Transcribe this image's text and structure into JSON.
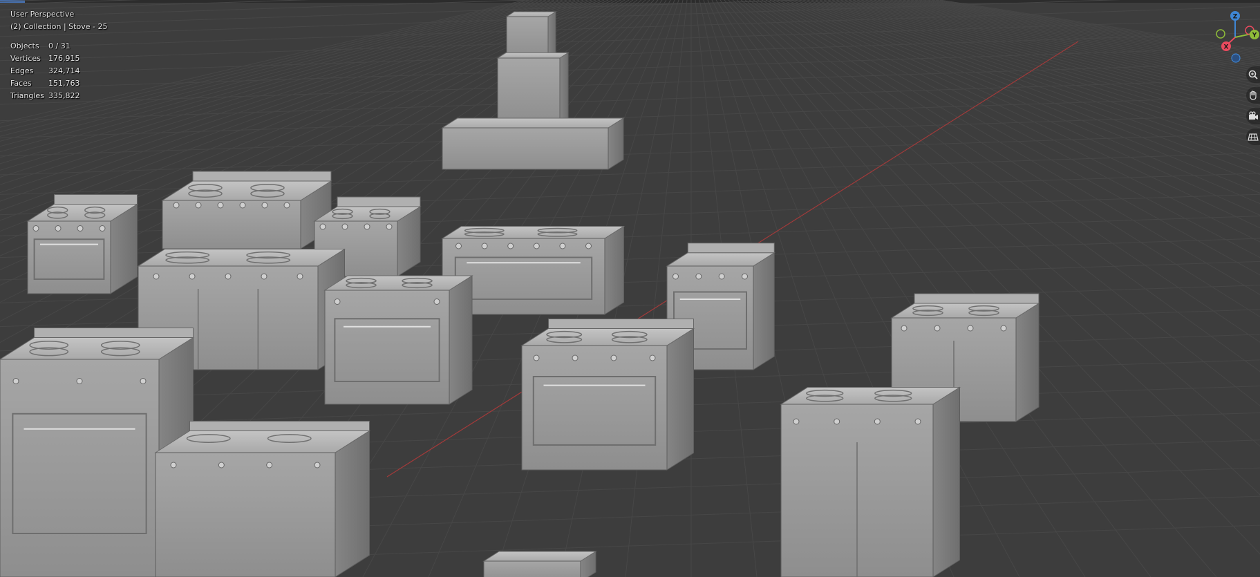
{
  "viewport": {
    "view_name": "User Perspective",
    "context": "(2) Collection | Stove - 25",
    "stats": [
      {
        "label": "Objects",
        "value": "0 / 31"
      },
      {
        "label": "Vertices",
        "value": "176,915"
      },
      {
        "label": "Edges",
        "value": "324,714"
      },
      {
        "label": "Faces",
        "value": "151,763"
      },
      {
        "label": "Triangles",
        "value": "335,822"
      }
    ]
  },
  "gizmo": {
    "axis_z": "Z",
    "axis_y": "Y",
    "axis_x": "X",
    "colors": {
      "x": "#e94a5e",
      "y": "#8fbd39",
      "z": "#3f86d4",
      "neg_x": "#7a2b36",
      "neg_y": "#4d6a24",
      "neg_z": "#2b4f80"
    }
  },
  "nav_buttons": [
    {
      "name": "zoom",
      "icon": "zoom-icon"
    },
    {
      "name": "pan",
      "icon": "hand-icon"
    },
    {
      "name": "camera",
      "icon": "camera-icon"
    },
    {
      "name": "ortho",
      "icon": "grid-icon"
    }
  ],
  "colors": {
    "background": "#3d3d3d",
    "grid_line": "#4a4a4a",
    "x_axis_line": "#a33c3c",
    "mesh_light": "#b9b9b9",
    "mesh_mid": "#9d9d9d",
    "mesh_dark": "#7a7a7a"
  }
}
